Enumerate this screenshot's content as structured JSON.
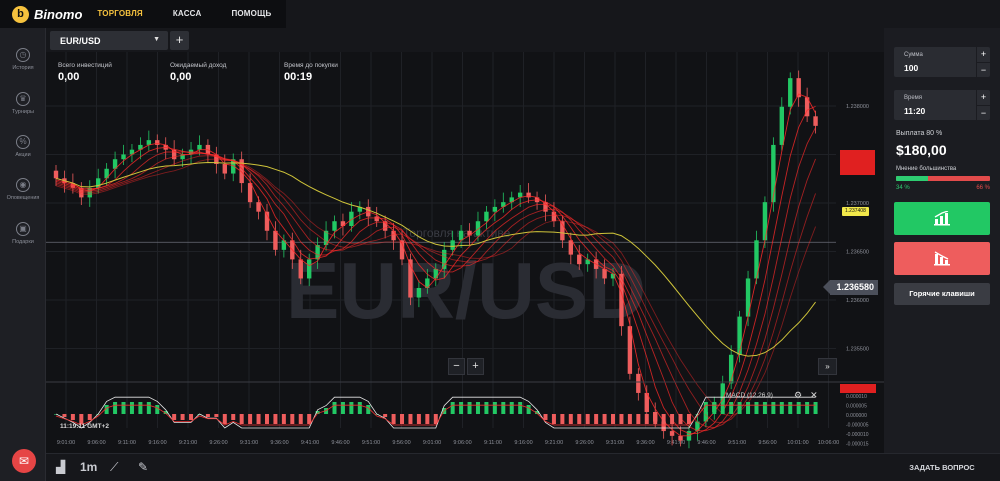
{
  "brand": {
    "name": "Binomo",
    "logo_letter": "b"
  },
  "nav": [
    "ТОРГОВЛЯ",
    "КАССА",
    "ПОМОЩЬ"
  ],
  "sidebar": [
    {
      "label": "История",
      "icon": "history-icon"
    },
    {
      "label": "Турниры",
      "icon": "trophy-icon"
    },
    {
      "label": "Акции",
      "icon": "percent-icon"
    },
    {
      "label": "Оповещения",
      "icon": "bell-icon"
    },
    {
      "label": "Подарки",
      "icon": "gift-icon"
    }
  ],
  "asset_tab": {
    "name": "EUR/USD",
    "caret": "▼",
    "add": "+"
  },
  "info": {
    "total_invest_label": "Всего инвестиций",
    "total_invest": "0,00",
    "expected_label": "Ожидаемый доход",
    "expected": "0,00",
    "time_label": "Время до покупки",
    "time": "00:19"
  },
  "chart_data": {
    "type": "candlestick",
    "watermark": "EUR/USD",
    "overlay_text": "Торговля на активе",
    "y_ticks": [
      "1.238000",
      "1.237500",
      "1.237000",
      "1.236500",
      "1.236000",
      "1.235500"
    ],
    "x_ticks": [
      "9:01:00",
      "9:06:00",
      "9:11:00",
      "9:16:00",
      "9:21:00",
      "9:26:00",
      "9:31:00",
      "9:36:00",
      "9:41:00",
      "9:46:00",
      "9:51:00",
      "9:56:00",
      "9:01:00",
      "9:06:00",
      "9:11:00",
      "9:16:00",
      "9:21:00",
      "9:26:00",
      "9:31:00",
      "9:36:00",
      "9:41:00",
      "9:46:00",
      "9:51:00",
      "9:56:00",
      "10:01:00",
      "10:06:00"
    ],
    "closes": [
      1.23725,
      1.2372,
      1.23715,
      1.23705,
      1.23715,
      1.23725,
      1.23735,
      1.23745,
      1.2375,
      1.23755,
      1.2376,
      1.23765,
      1.2376,
      1.23755,
      1.23745,
      1.2375,
      1.23755,
      1.2376,
      1.2375,
      1.2374,
      1.2373,
      1.23745,
      1.2372,
      1.237,
      1.2369,
      1.2367,
      1.2365,
      1.2366,
      1.2364,
      1.2362,
      1.2364,
      1.23655,
      1.2367,
      1.2368,
      1.23675,
      1.2369,
      1.23695,
      1.23685,
      1.2368,
      1.2367,
      1.2366,
      1.2364,
      1.236,
      1.2361,
      1.2362,
      1.2363,
      1.2365,
      1.2366,
      1.2367,
      1.23665,
      1.2368,
      1.2369,
      1.23695,
      1.237,
      1.23705,
      1.2371,
      1.23705,
      1.237,
      1.2369,
      1.2368,
      1.2366,
      1.23645,
      1.23635,
      1.2364,
      1.2363,
      1.2362,
      1.23625,
      1.2357,
      1.2352,
      1.235,
      1.2348,
      1.2347,
      1.2346,
      1.23455,
      1.2345,
      1.2346,
      1.2347,
      1.2348,
      1.2349,
      1.2351,
      1.2354,
      1.2358,
      1.2362,
      1.2366,
      1.237,
      1.2376,
      1.238,
      1.2383,
      1.2381,
      1.2379,
      1.2378
    ],
    "ma_color": "#cfc43a",
    "ribbon_color": "#ff2a2a",
    "ma_tag": "1.237408",
    "current_price": "1.236580",
    "macd": {
      "label": "MACD (12,26,9)",
      "y_ticks": [
        "0.000010",
        "0.000005",
        "0.000000",
        "-0.000005",
        "-0.000010",
        "-0.000015"
      ]
    }
  },
  "time_display": "11:19:11 GMT+2",
  "tools": [
    "chart-type-icon",
    "1m",
    "indicators-icon",
    "drawing-icon"
  ],
  "panel": {
    "amount_label": "Сумма",
    "amount": "100",
    "time_label": "Время",
    "time": "11:20",
    "payout_label": "Выплата 80 %",
    "payout": "$180,00",
    "opinion_label": "Мнение большинства",
    "opinion_up": 34,
    "opinion_up_text": "34 %",
    "opinion_down_text": "66 %",
    "hotkeys": "Горячие клавиши",
    "ask": "ЗАДАТЬ ВОПРОС"
  },
  "colors": {
    "up": "#22c864",
    "down": "#ee5d5d",
    "accent": "#f6c23e"
  }
}
